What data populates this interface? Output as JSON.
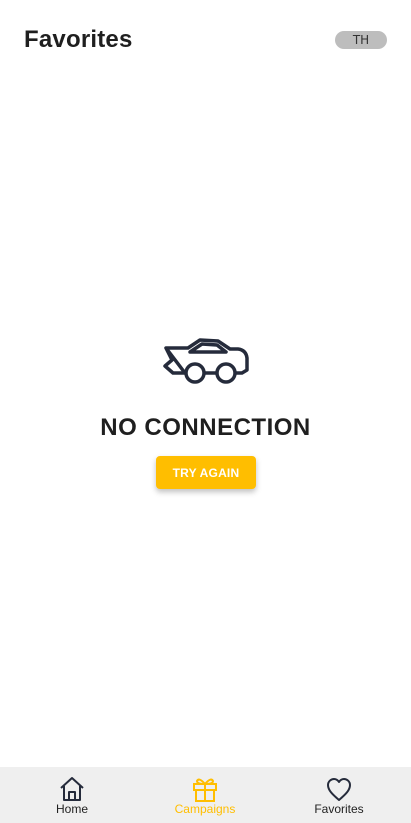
{
  "header": {
    "title": "Favorites",
    "language": "TH"
  },
  "empty_state": {
    "icon": "car-icon",
    "title": "NO CONNECTION",
    "button_label": "TRY AGAIN"
  },
  "bottom_nav": {
    "items": [
      {
        "label": "Home",
        "icon": "home-icon",
        "active": false
      },
      {
        "label": "Campaigns",
        "icon": "gift-icon",
        "active": true
      },
      {
        "label": "Favorites",
        "icon": "heart-icon",
        "active": false
      }
    ]
  },
  "colors": {
    "accent": "#ffbe00",
    "text": "#1f1f1f",
    "nav_background": "#efefef",
    "badge_background": "#bdbdbd"
  }
}
